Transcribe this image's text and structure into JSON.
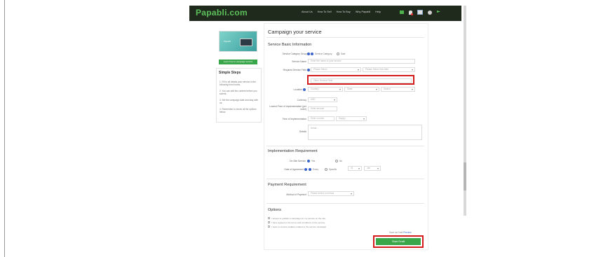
{
  "header": {
    "logo": "Papabli.com",
    "nav": [
      "About Us",
      "How To Sell",
      "How To Buy",
      "Why Papabli",
      "Help"
    ],
    "icons": [
      "message-icon",
      "user-icon",
      "notification-icon",
      "settings-icon",
      "flag-icon"
    ]
  },
  "sidebar": {
    "banner_caption": "Papabli",
    "learn_button": "Learn how to campaign service",
    "steps_title": "Simple Steps",
    "steps": [
      "1. Fill in all details your service in the following form boxes.",
      "2. You can edit the content before you submit.",
      "3. Set the campaign date and stay with us.",
      "4. Remember to check all the options below."
    ]
  },
  "form": {
    "page_title": "Campaign your service",
    "sections": {
      "basic": "Service Basic Information",
      "implementation": "Implementation Requirement",
      "payment": "Payment Requirement",
      "options": "Options"
    },
    "service_category": {
      "label": "Service Category Group",
      "options": [
        "Service Category",
        "Sale"
      ]
    },
    "service_name": {
      "label": "Service Name",
      "placeholder": "Enter the name of your service"
    },
    "required_service_field": {
      "label": "Required Service Field",
      "select1": "Please Select",
      "select2": "Please Select Sub-field",
      "other_placeholder": "Other Service Field"
    },
    "location": {
      "label": "Location",
      "selects": [
        "Country",
        "State",
        "District"
      ]
    },
    "currency": {
      "label": "Currency",
      "value": "USD"
    },
    "lowest_price": {
      "label": "Lowest Price of Implementation (per order)",
      "placeholder": "Enter amount"
    },
    "time_of_implementation": {
      "label": "Time of Implementation",
      "placeholder": "Enter number",
      "unit": "Day(s)"
    },
    "details": {
      "label": "Details",
      "placeholder": "Detail..."
    },
    "on_site": {
      "label": "On-Site Service",
      "options": [
        "Yes",
        "No"
      ]
    },
    "date_of_agreement": {
      "label": "Date of Agreement",
      "options": [
        "Every",
        "Specific"
      ],
      "selects": [
        "01",
        "Jan"
      ]
    },
    "method_of_payment": {
      "label": "Method of Payment",
      "value": "Please select a method"
    },
    "option_checks": [
      "I accept to publish a campaign for my service on the site.",
      "I have agreed to the terms and conditions of the service.",
      "I want to receive updates related to the service campaign."
    ],
    "save_text": "Save as Draft",
    "preview_text": "Preview",
    "submit_label": "Start Draft"
  }
}
